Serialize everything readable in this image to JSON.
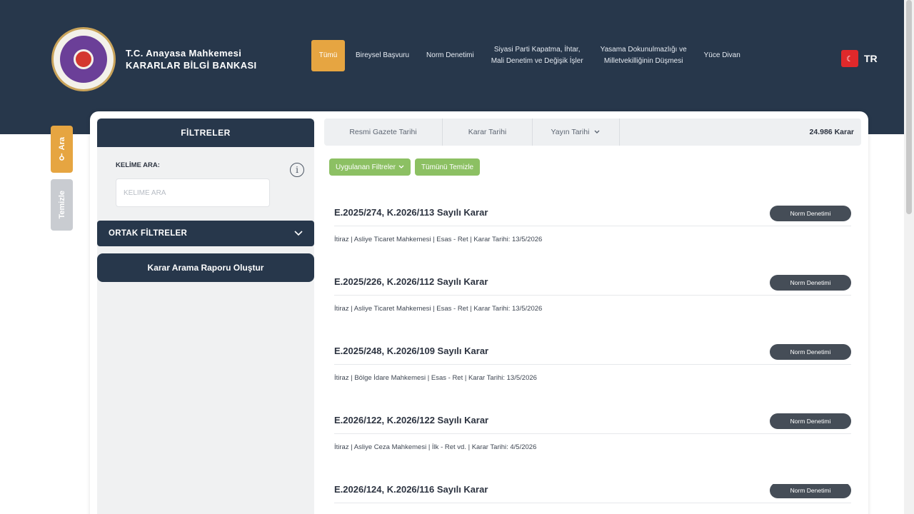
{
  "header": {
    "brand_line1": "T.C. Anayasa Mahkemesi",
    "brand_line2": "KARARLAR BİLGİ BANKASI",
    "nav": [
      {
        "label": "Tümü",
        "active": true
      },
      {
        "label": "Bireysel Başvuru"
      },
      {
        "label": "Norm Denetimi"
      },
      {
        "label_line1": "Siyasi Parti Kapatma, İhtar,",
        "label_line2": "Mali Denetim ve Değişik İşler"
      },
      {
        "label_line1": "Yasama Dokunulmazlığı ve",
        "label_line2": "Milletvekilliğinin Düşmesi"
      },
      {
        "label": "Yüce Divan"
      }
    ],
    "language": "TR",
    "accent_color": "#e6a541",
    "bar_color": "#27374b"
  },
  "side_tabs": {
    "search": "Ara",
    "clear": "Temizle"
  },
  "filters": {
    "title": "FİLTRELER",
    "keyword_label": "KELİME ARA:",
    "keyword_placeholder": "KELİME ARA",
    "keyword_value": "",
    "common_filters": "ORTAK FİLTRELER",
    "report_button": "Karar Arama Raporu Oluştur"
  },
  "sort": {
    "items": [
      "Resmi Gazete Tarihi",
      "Karar Tarihi",
      "Yayın Tarihi"
    ],
    "count": "24.986 Karar"
  },
  "chips": {
    "applied": "Uygulanan Filtreler",
    "clear": "Tümünü Temizle"
  },
  "results": [
    {
      "title": "E.2025/274, K.2026/113 Sayılı Karar",
      "badge": "Norm Denetimi",
      "meta": "İtiraz | Asliye Ticaret Mahkemesi | Esas - Ret | Karar Tarihi: 13/5/2026"
    },
    {
      "title": "E.2025/226, K.2026/112 Sayılı Karar",
      "badge": "Norm Denetimi",
      "meta": "İtiraz | Asliye Ticaret Mahkemesi | Esas - Ret | Karar Tarihi: 13/5/2026"
    },
    {
      "title": "E.2025/248, K.2026/109 Sayılı Karar",
      "badge": "Norm Denetimi",
      "meta": "İtiraz | Bölge İdare Mahkemesi | Esas - Ret | Karar Tarihi: 13/5/2026"
    },
    {
      "title": "E.2026/122, K.2026/122 Sayılı Karar",
      "badge": "Norm Denetimi",
      "meta": "İtiraz | Asliye Ceza Mahkemesi | İlk - Ret vd. | Karar Tarihi: 4/5/2026"
    },
    {
      "title": "E.2026/124, K.2026/116 Sayılı Karar",
      "badge": "Norm Denetimi",
      "meta": ""
    }
  ]
}
